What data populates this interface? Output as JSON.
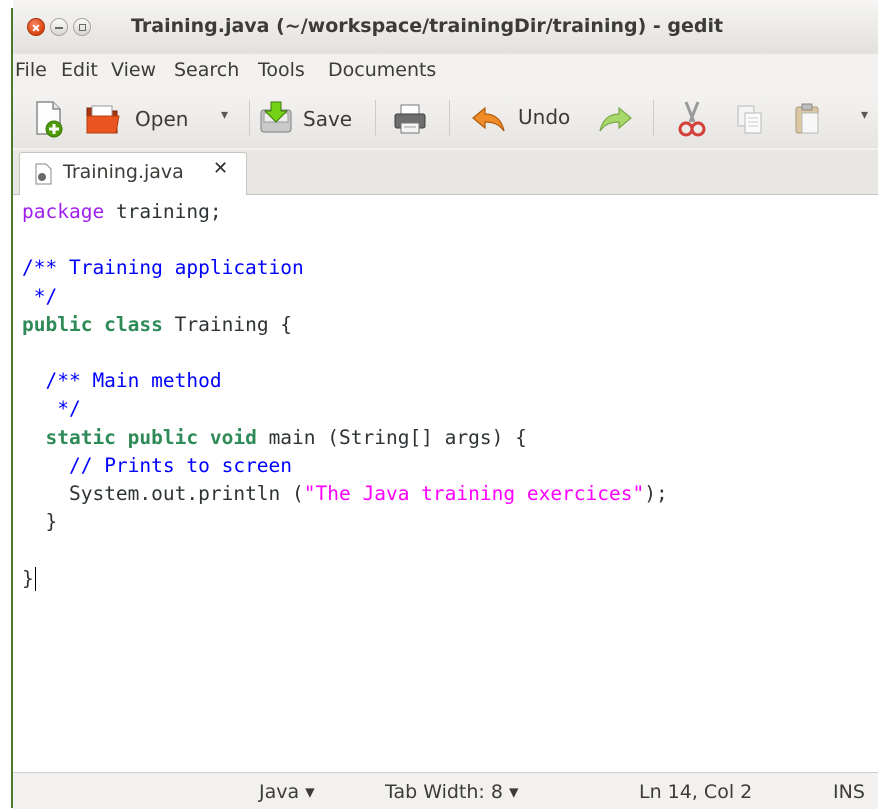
{
  "window": {
    "title": "Training.java (~/workspace/trainingDir/training) - gedit"
  },
  "menubar": {
    "items": [
      "File",
      "Edit",
      "View",
      "Search",
      "Tools",
      "Documents"
    ]
  },
  "toolbar": {
    "open_label": "Open",
    "save_label": "Save",
    "undo_label": "Undo",
    "dropdown_glyph": "▾",
    "icons": [
      "new-document-icon",
      "open-folder-icon",
      "save-icon",
      "print-icon",
      "undo-icon",
      "redo-icon",
      "cut-icon",
      "copy-icon",
      "paste-icon"
    ]
  },
  "tab": {
    "label": "Training.java",
    "close_glyph": "✕"
  },
  "editor": {
    "language": "Java",
    "code_lines": [
      "package training;",
      "",
      "/** Training application",
      " */",
      "public class Training {",
      "",
      "  /** Main method",
      "   */",
      "  static public void main (String[] args) {",
      "    // Prints to screen",
      "    System.out.println (\"The Java training exercices\");",
      "  }",
      "",
      "}"
    ]
  },
  "statusbar": {
    "language": "Java ▾",
    "tab_width": "Tab Width: 8 ▾",
    "position": "Ln 14, Col 2",
    "mode": "INS"
  },
  "colors": {
    "keyword": "#a020f0",
    "type": "#2e8b57",
    "comment": "#0000ff",
    "string": "#ff00ff",
    "accent_close": "#dd4814"
  }
}
